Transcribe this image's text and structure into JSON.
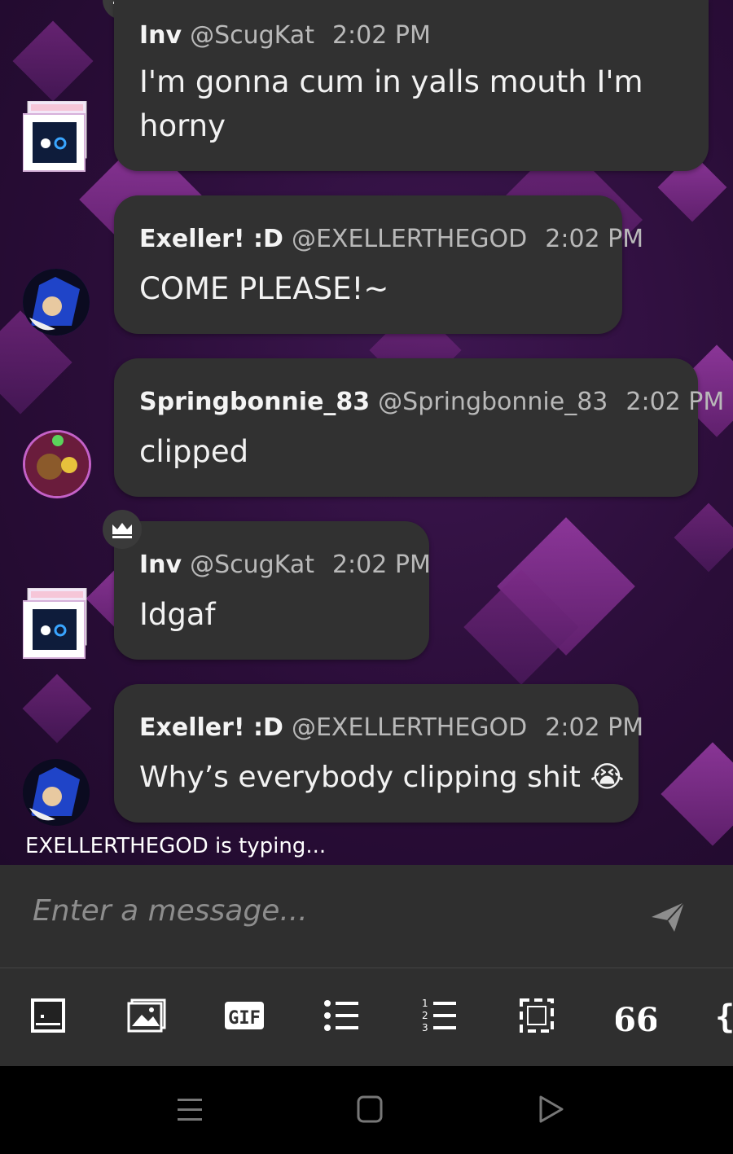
{
  "messages": [
    {
      "name": "Inv",
      "handle": "@ScugKat",
      "time": "2:02 PM",
      "text_line1": "I'm gonna cum in yalls mouth I'm",
      "text_line2": "horny"
    },
    {
      "name": "Exeller! :D",
      "handle": "@EXELLERTHEGOD",
      "time": "2:02 PM",
      "text": "COME PLEASE!~"
    },
    {
      "name": "Springbonnie_83",
      "handle": "@Springbonnie_83",
      "time": "2:02 PM",
      "text": "clipped"
    },
    {
      "name": "Inv",
      "handle": "@ScugKat",
      "time": "2:02 PM",
      "text": "Idgaf"
    },
    {
      "name": "Exeller! :D",
      "handle": "@EXELLERTHEGOD",
      "time": "2:02 PM",
      "text": "Why’s everybody clipping shit",
      "emoji": "😭"
    }
  ],
  "typing_indicator": "EXELLERTHEGOD is typing...",
  "composer": {
    "placeholder": "Enter a message..."
  },
  "toolbar": {
    "icons": [
      "emoji-face-icon",
      "image-icon",
      "gif-icon",
      "bullet-list-icon",
      "numbered-list-icon",
      "spoiler-icon",
      "quote-icon",
      "code-brace-icon"
    ],
    "gif_label": "GIF",
    "quote_label": "66",
    "code_label": "{"
  },
  "colors": {
    "bubble": "#313131",
    "background": "#2a0f36",
    "accent": "#8a2f96"
  }
}
